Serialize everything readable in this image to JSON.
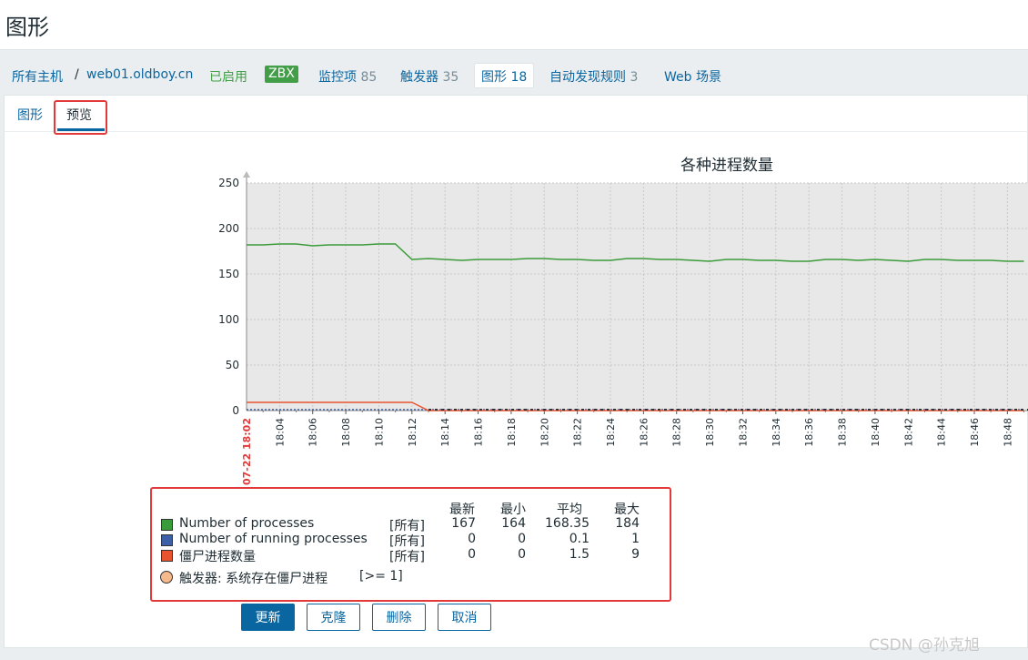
{
  "page_title": "图形",
  "breadcrumb": {
    "all_hosts": "所有主机",
    "separator": "/",
    "host": "web01.oldboy.cn",
    "status": "已启用",
    "zbx": "ZBX"
  },
  "nav": {
    "items_label": "监控项",
    "items_count": "85",
    "triggers_label": "触发器",
    "triggers_count": "35",
    "graphs_label": "图形",
    "graphs_count": "18",
    "discovery_label": "自动发现规则",
    "discovery_count": "3",
    "web_label": "Web 场景"
  },
  "tabs": {
    "graph": "图形",
    "preview": "预览"
  },
  "colors": {
    "green": "#3a9b3a",
    "blue": "#3d5fa8",
    "red": "#e8542f",
    "trigger": "#f5b98c",
    "accent": "#0a66a0"
  },
  "chart_data": {
    "type": "line",
    "title": "各种进程数量",
    "ylim": [
      0,
      250
    ],
    "y_ticks": [
      "250",
      "200",
      "150",
      "100",
      "50",
      "0"
    ],
    "x_start_label": "07-22 18:02",
    "x_ticks": [
      "18:04",
      "18:06",
      "18:08",
      "18:10",
      "18:12",
      "18:14",
      "18:16",
      "18:18",
      "18:20",
      "18:22",
      "18:24",
      "18:26",
      "18:28",
      "18:30",
      "18:32",
      "18:34",
      "18:36",
      "18:38",
      "18:40",
      "18:42",
      "18:44",
      "18:46",
      "18:48"
    ],
    "series": [
      {
        "name": "Number of processes",
        "color": "#3a9b3a",
        "x": [
          0,
          1,
          2,
          3,
          4,
          5,
          6,
          7,
          8,
          9,
          10,
          11,
          12,
          13,
          14,
          15,
          16,
          17,
          18,
          19,
          20,
          21,
          22,
          23,
          24,
          25,
          26,
          27,
          28,
          29,
          30,
          31,
          32,
          33,
          34,
          35,
          36,
          37,
          38,
          39,
          40,
          41,
          42,
          43,
          44,
          45,
          46,
          47
        ],
        "values": [
          182,
          182,
          183,
          183,
          181,
          182,
          182,
          182,
          183,
          183,
          166,
          167,
          166,
          165,
          166,
          166,
          166,
          167,
          167,
          166,
          166,
          165,
          165,
          167,
          167,
          166,
          166,
          165,
          164,
          166,
          166,
          165,
          165,
          164,
          164,
          166,
          166,
          165,
          166,
          165,
          164,
          166,
          166,
          165,
          165,
          165,
          164,
          164
        ]
      },
      {
        "name": "Number of running processes",
        "color": "#3d5fa8",
        "x": [
          0,
          47
        ],
        "values": [
          1,
          1
        ]
      },
      {
        "name": "僵尸进程数量",
        "color": "#e8542f",
        "x": [
          0,
          1,
          2,
          3,
          4,
          5,
          6,
          7,
          8,
          9,
          10,
          11,
          47
        ],
        "values": [
          9,
          9,
          9,
          9,
          9,
          9,
          9,
          9,
          9,
          9,
          9,
          0,
          0
        ]
      }
    ]
  },
  "legend": {
    "headers": {
      "latest": "最新",
      "min": "最小",
      "avg": "平均",
      "max": "最大"
    },
    "rows": [
      {
        "name": "Number of processes",
        "scope": "[所有]",
        "latest": "167",
        "min": "164",
        "avg": "168.35",
        "max": "184"
      },
      {
        "name": "Number of running processes",
        "scope": "[所有]",
        "latest": "0",
        "min": "0",
        "avg": "0.1",
        "max": "1"
      },
      {
        "name": "僵尸进程数量",
        "scope": "[所有]",
        "latest": "0",
        "min": "0",
        "avg": "1.5",
        "max": "9"
      }
    ],
    "trigger": {
      "label": "触发器: 系统存在僵尸进程",
      "condition": "[>= 1]"
    }
  },
  "buttons": {
    "update": "更新",
    "clone": "克隆",
    "delete": "删除",
    "cancel": "取消"
  },
  "watermark": "CSDN @孙克旭"
}
